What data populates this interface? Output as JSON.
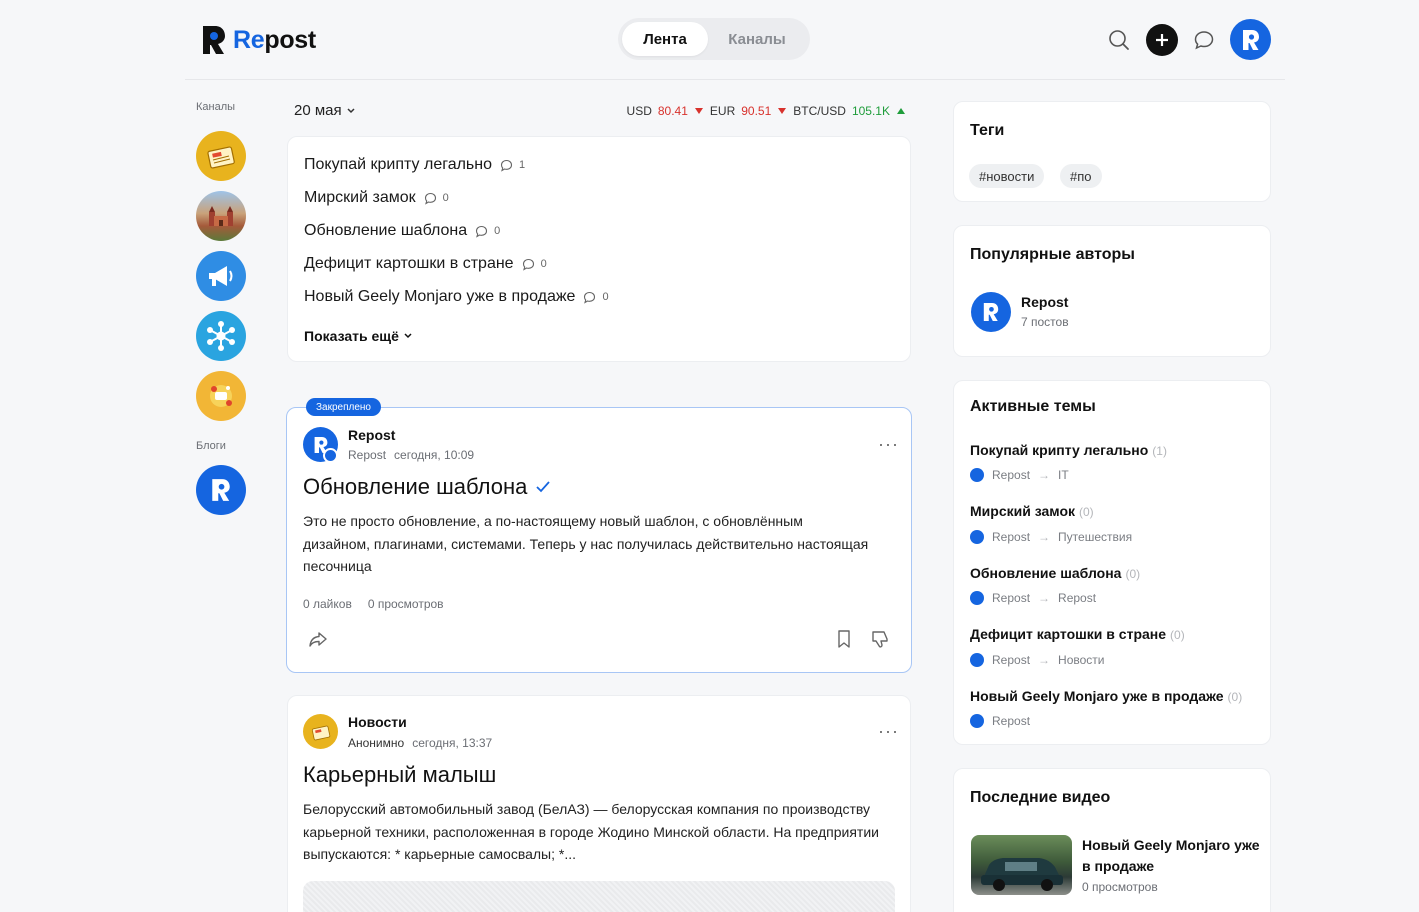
{
  "header": {
    "logo_re": "Re",
    "logo_post": "post",
    "tabs": [
      {
        "label": "Лента",
        "active": true
      },
      {
        "label": "Каналы",
        "active": false
      }
    ],
    "icons": [
      "search-icon",
      "plus-icon",
      "chat-icon",
      "profile-avatar"
    ]
  },
  "rail": {
    "channels_label": "Каналы",
    "blogs_label": "Блоги",
    "channels": [
      "news-channel",
      "travel-channel",
      "megaphone-channel",
      "network-channel",
      "food-channel"
    ],
    "blogs": [
      "repost-blog"
    ]
  },
  "feed": {
    "date": "20 мая",
    "rates": {
      "usd_label": "USD",
      "usd_value": "80.41",
      "eur_label": "EUR",
      "eur_value": "90.51",
      "btc_label": "BTC/USD",
      "btc_value": "105.1K"
    },
    "topics": [
      {
        "title": "Покупай крипту легально",
        "comments": "1"
      },
      {
        "title": "Мирский замок",
        "comments": "0"
      },
      {
        "title": "Обновление шаблона",
        "comments": "0"
      },
      {
        "title": "Дефицит картошки в стране",
        "comments": "0"
      },
      {
        "title": "Новый Geely Monjaro уже в продаже",
        "comments": "0"
      }
    ],
    "show_more": "Показать ещё",
    "pinned_post": {
      "badge": "Закреплено",
      "author": "Repost",
      "channel": "Repost",
      "time": "сегодня, 10:09",
      "title": "Обновление шаблона",
      "body": "Это не просто обновление, а по-настоящему новый шаблон, с обновлённым дизайном, плагинами, системами. Теперь у нас получилась действительно настоящая песочница",
      "likes": "0 лайков",
      "views": "0 просмотров",
      "menu": "···"
    },
    "news_post": {
      "author": "Новости",
      "channel": "Анонимно",
      "time": "сегодня, 13:37",
      "title": "Карьерный малыш",
      "body": "Белорусский автомобильный завод (БелАЗ) — белорусская компания по производству карьерной техники, расположенная в городе Жодино Минской области. На предприятии выпускаются: * карьерные самосвалы; *...",
      "menu": "···"
    }
  },
  "sidebar": {
    "tags_title": "Теги",
    "tags": [
      "#новости",
      "#по"
    ],
    "authors_title": "Популярные авторы",
    "author_name": "Repost",
    "author_posts": "7 постов",
    "active_title": "Активные темы",
    "active_topics": [
      {
        "title": "Покупай крипту легально",
        "count": "(1)",
        "author": "Repost",
        "category": "IT"
      },
      {
        "title": "Мирский замок",
        "count": "(0)",
        "author": "Repost",
        "category": "Путешествия"
      },
      {
        "title": "Обновление шаблона",
        "count": "(0)",
        "author": "Repost",
        "category": "Repost"
      },
      {
        "title": "Дефицит картошки в стране",
        "count": "(0)",
        "author": "Repost",
        "category": "Новости"
      },
      {
        "title": "Новый Geely Monjaro уже в продаже",
        "count": "(0)",
        "author": "Repost",
        "category": ""
      }
    ],
    "arrow": "→",
    "videos_title": "Последние видео",
    "video_title": "Новый Geely Monjaro уже в продаже",
    "video_views": "0 просмотров"
  },
  "colors": {
    "accent": "#1565e0",
    "down": "#d8322d",
    "up": "#1f9d3b",
    "news_yellow": "#e8b31e"
  }
}
